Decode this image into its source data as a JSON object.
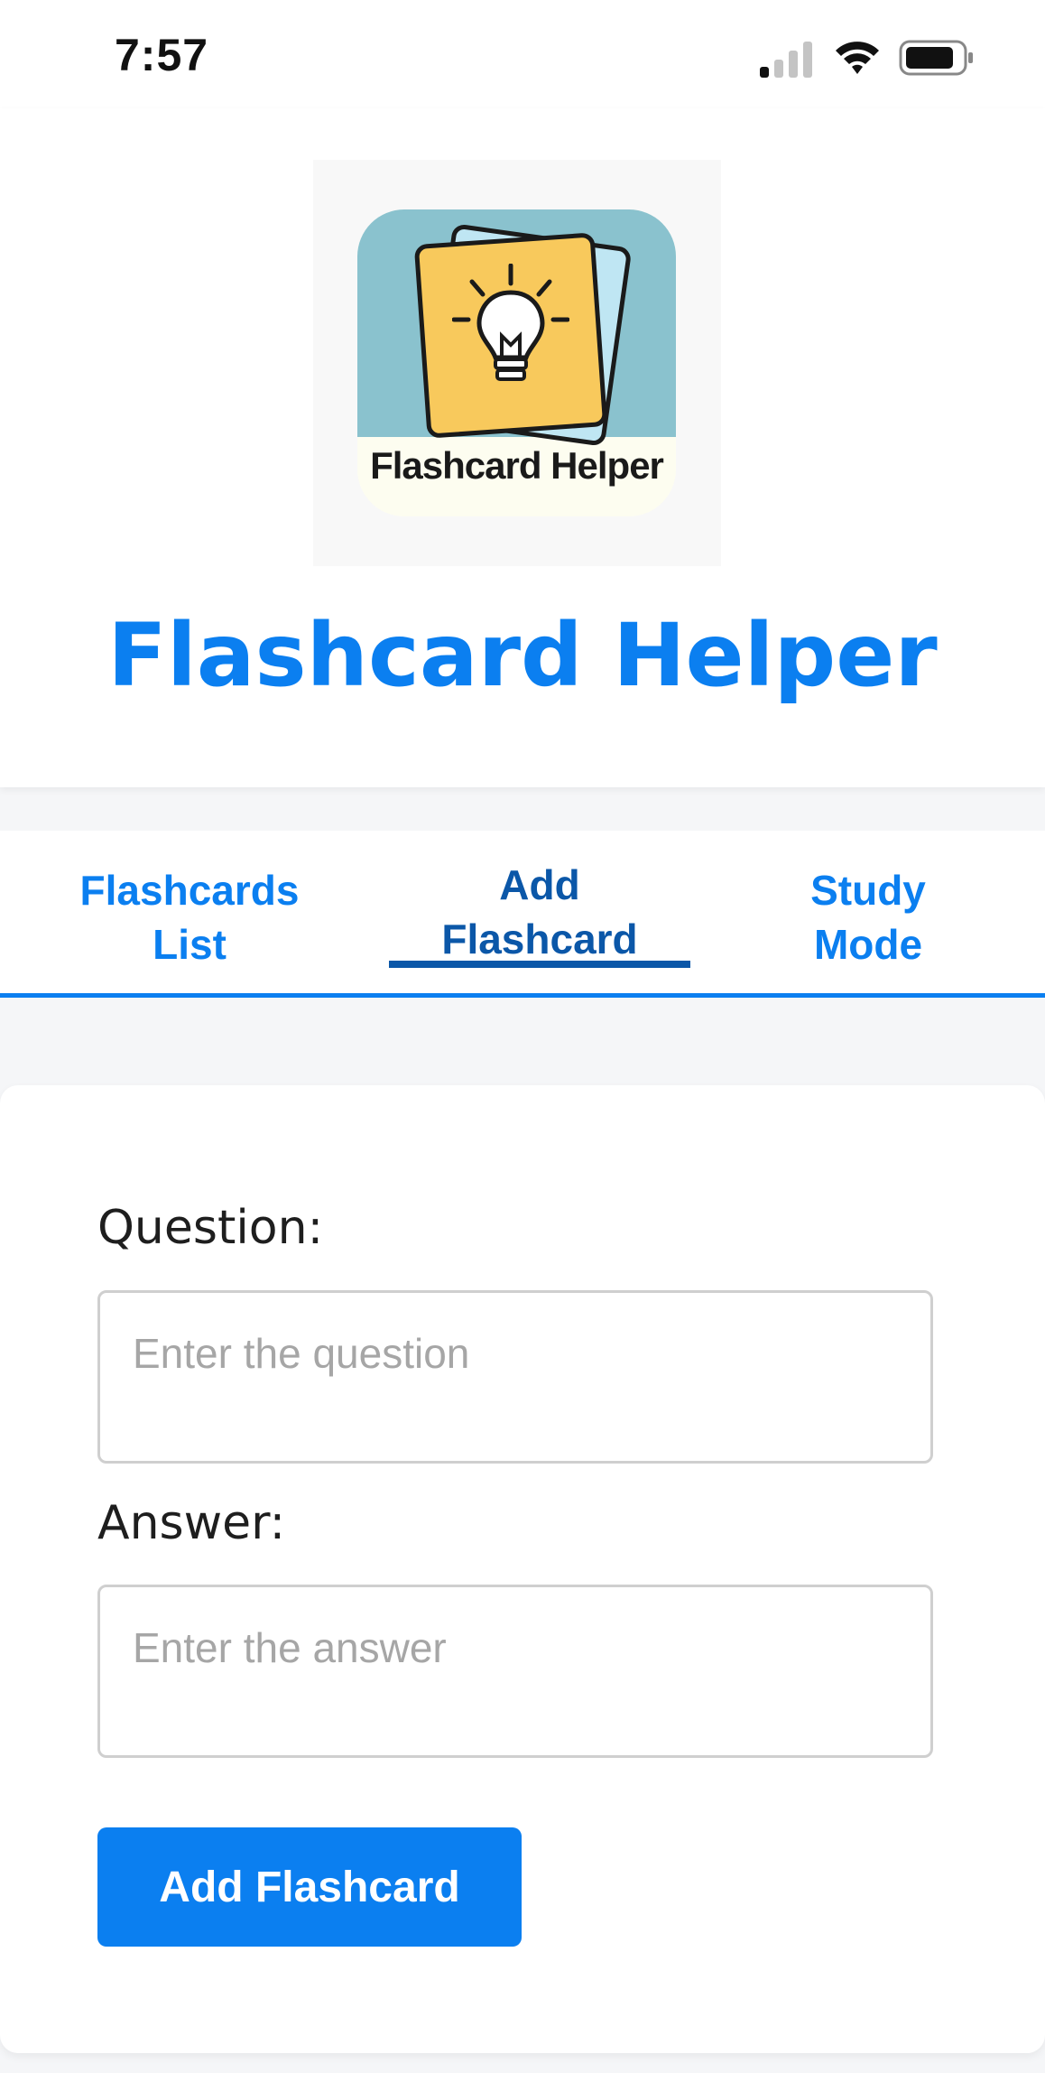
{
  "status_bar": {
    "time": "7:57",
    "signal_icon": "cellular-signal-icon",
    "wifi_icon": "wifi-icon",
    "battery_icon": "battery-icon"
  },
  "header": {
    "logo_text": "Flashcard Helper",
    "title": "Flashcard Helper"
  },
  "tabs": [
    {
      "label": "Flashcards\nList",
      "active": false
    },
    {
      "label": "Add\nFlashcard",
      "active": true
    },
    {
      "label": "Study\nMode",
      "active": false
    }
  ],
  "form": {
    "question_label": "Question:",
    "question_placeholder": "Enter the question",
    "question_value": "",
    "answer_label": "Answer:",
    "answer_placeholder": "Enter the answer",
    "answer_value": "",
    "submit_label": "Add Flashcard"
  },
  "colors": {
    "accent": "#0b7ff0",
    "active_tab": "#0b57a8"
  }
}
